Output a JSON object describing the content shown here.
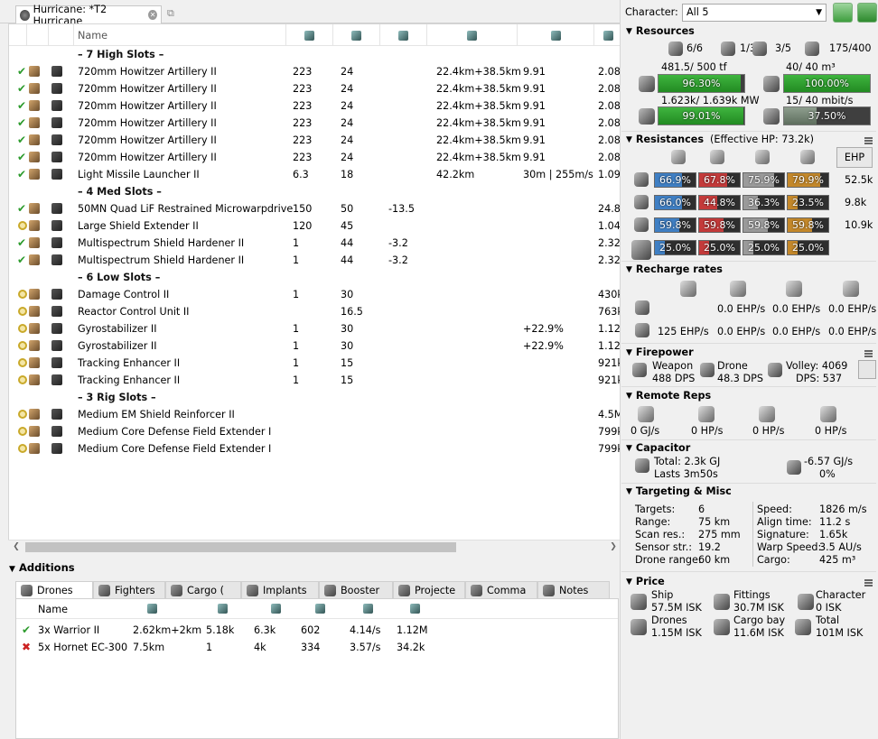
{
  "title_tab": "Hurricane: *T2 Hurricane",
  "fit_header": {
    "name": "Name"
  },
  "fit_rows": [
    {
      "type": "section",
      "label": "– 7 High Slots –"
    },
    {
      "type": "mod",
      "state": "ok",
      "name": "720mm Howitzer Artillery II",
      "c1": "223",
      "c2": "24",
      "c3": "",
      "c4": "22.4km+38.5km",
      "c5": "9.91",
      "c6": "2.08M"
    },
    {
      "type": "mod",
      "state": "ok",
      "name": "720mm Howitzer Artillery II",
      "c1": "223",
      "c2": "24",
      "c3": "",
      "c4": "22.4km+38.5km",
      "c5": "9.91",
      "c6": "2.08M"
    },
    {
      "type": "mod",
      "state": "ok",
      "name": "720mm Howitzer Artillery II",
      "c1": "223",
      "c2": "24",
      "c3": "",
      "c4": "22.4km+38.5km",
      "c5": "9.91",
      "c6": "2.08M"
    },
    {
      "type": "mod",
      "state": "ok",
      "name": "720mm Howitzer Artillery II",
      "c1": "223",
      "c2": "24",
      "c3": "",
      "c4": "22.4km+38.5km",
      "c5": "9.91",
      "c6": "2.08M"
    },
    {
      "type": "mod",
      "state": "ok",
      "name": "720mm Howitzer Artillery II",
      "c1": "223",
      "c2": "24",
      "c3": "",
      "c4": "22.4km+38.5km",
      "c5": "9.91",
      "c6": "2.08M"
    },
    {
      "type": "mod",
      "state": "ok",
      "name": "720mm Howitzer Artillery II",
      "c1": "223",
      "c2": "24",
      "c3": "",
      "c4": "22.4km+38.5km",
      "c5": "9.91",
      "c6": "2.08M"
    },
    {
      "type": "mod",
      "state": "ok",
      "name": "Light Missile Launcher II",
      "c1": "6.3",
      "c2": "18",
      "c3": "",
      "c4": "42.2km",
      "c5": "30m | 255m/s",
      "c6": "1.09M"
    },
    {
      "type": "section",
      "label": "– 4 Med Slots –"
    },
    {
      "type": "mod",
      "state": "ok",
      "name": "50MN Quad LiF Restrained Microwarpdrive",
      "c1": "150",
      "c2": "50",
      "c3": "-13.5",
      "c4": "",
      "c5": "",
      "c6": "24.8k"
    },
    {
      "type": "mod",
      "state": "off",
      "name": "Large Shield Extender II",
      "c1": "120",
      "c2": "45",
      "c3": "",
      "c4": "",
      "c5": "",
      "c6": "1.04M"
    },
    {
      "type": "mod",
      "state": "ok",
      "name": "Multispectrum Shield Hardener II",
      "c1": "1",
      "c2": "44",
      "c3": "-3.2",
      "c4": "",
      "c5": "",
      "c6": "2.32M"
    },
    {
      "type": "mod",
      "state": "ok",
      "name": "Multispectrum Shield Hardener II",
      "c1": "1",
      "c2": "44",
      "c3": "-3.2",
      "c4": "",
      "c5": "",
      "c6": "2.32M"
    },
    {
      "type": "section",
      "label": "– 6 Low Slots –"
    },
    {
      "type": "mod",
      "state": "off",
      "name": "Damage Control II",
      "c1": "1",
      "c2": "30",
      "c3": "",
      "c4": "",
      "c5": "",
      "c6": "430k"
    },
    {
      "type": "mod",
      "state": "off",
      "name": "Reactor Control Unit II",
      "c1": "",
      "c2": "16.5",
      "c3": "",
      "c4": "",
      "c5": "",
      "c6": "763k"
    },
    {
      "type": "mod",
      "state": "off",
      "name": "Gyrostabilizer II",
      "c1": "1",
      "c2": "30",
      "c3": "",
      "c4": "",
      "c5": "+22.9%",
      "c6": "1.12M"
    },
    {
      "type": "mod",
      "state": "off",
      "name": "Gyrostabilizer II",
      "c1": "1",
      "c2": "30",
      "c3": "",
      "c4": "",
      "c5": "+22.9%",
      "c6": "1.12M"
    },
    {
      "type": "mod",
      "state": "off",
      "name": "Tracking Enhancer II",
      "c1": "1",
      "c2": "15",
      "c3": "",
      "c4": "",
      "c5": "",
      "c6": "921k"
    },
    {
      "type": "mod",
      "state": "off",
      "name": "Tracking Enhancer II",
      "c1": "1",
      "c2": "15",
      "c3": "",
      "c4": "",
      "c5": "",
      "c6": "921k"
    },
    {
      "type": "section",
      "label": "– 3 Rig Slots –"
    },
    {
      "type": "mod",
      "state": "off",
      "name": "Medium EM Shield Reinforcer II",
      "c1": "",
      "c2": "",
      "c3": "",
      "c4": "",
      "c5": "",
      "c6": "4.5M"
    },
    {
      "type": "mod",
      "state": "off",
      "name": "Medium Core Defense Field Extender I",
      "c1": "",
      "c2": "",
      "c3": "",
      "c4": "",
      "c5": "",
      "c6": "799k"
    },
    {
      "type": "mod",
      "state": "off",
      "name": "Medium Core Defense Field Extender I",
      "c1": "",
      "c2": "",
      "c3": "",
      "c4": "",
      "c5": "",
      "c6": "799k"
    }
  ],
  "additions": {
    "title": "Additions",
    "tabs": [
      "Drones",
      "Fighters",
      "Cargo (",
      "Implants",
      "Booster",
      "Projecte",
      "Comma",
      "Notes"
    ],
    "header": {
      "name": "Name"
    },
    "drones": [
      {
        "state": "ok",
        "name": "3x Warrior II",
        "c1": "2.62km+2km",
        "c2": "5.18k",
        "c3": "6.3k",
        "c4": "602",
        "c5": "4.14/s",
        "c6": "1.12M"
      },
      {
        "state": "x",
        "name": "5x Hornet EC-300",
        "c1": "7.5km",
        "c2": "1",
        "c3": "4k",
        "c4": "334",
        "c5": "3.57/s",
        "c6": "34.2k"
      }
    ]
  },
  "character": {
    "label": "Character:",
    "value": "All 5"
  },
  "resources": {
    "title": "Resources",
    "hi": "6/6",
    "turret": "1/3",
    "launcher": "3/5",
    "calib": "175/400",
    "cpu_text": "481.5/ 500 tf",
    "cpu_pct": "96.30%",
    "cpu_frac": 0.963,
    "drone_bay": "40/ 40 m³",
    "drone_bay_pct": "100.00%",
    "drone_bay_frac": 1.0,
    "pg_text": "1.623k/ 1.639k MW",
    "pg_pct": "99.01%",
    "pg_frac": 0.9901,
    "bandwidth": "15/ 40 mbit/s",
    "bandwidth_pct": "37.50%",
    "bandwidth_frac": 0.375
  },
  "resistances": {
    "title": "Resistances",
    "ehp_total": "(Effective HP: 73.2k)",
    "ehp_button": "EHP",
    "rows": [
      {
        "layer": "shield",
        "vals": [
          "66.9%",
          "67.8%",
          "75.9%",
          "79.9%"
        ],
        "fr": [
          0.669,
          0.678,
          0.759,
          0.799
        ],
        "ehp": "52.5k"
      },
      {
        "layer": "armor",
        "vals": [
          "66.0%",
          "44.8%",
          "36.3%",
          "23.5%"
        ],
        "fr": [
          0.66,
          0.448,
          0.363,
          0.235
        ],
        "ehp": "9.8k"
      },
      {
        "layer": "hull",
        "vals": [
          "59.8%",
          "59.8%",
          "59.8%",
          "59.8%"
        ],
        "fr": [
          0.598,
          0.598,
          0.598,
          0.598
        ],
        "ehp": "10.9k"
      },
      {
        "layer": "damage-pattern",
        "vals": [
          "25.0%",
          "25.0%",
          "25.0%",
          "25.0%"
        ],
        "fr": [
          0.25,
          0.25,
          0.25,
          0.25
        ],
        "ehp": ""
      }
    ],
    "colors": [
      "#3f7fc4",
      "#c43a3a",
      "#9a9a9a",
      "#c4882a"
    ]
  },
  "recharge": {
    "title": "Recharge rates",
    "r1": [
      "0.0 EHP/s",
      "0.0 EHP/s",
      "0.0 EHP/s"
    ],
    "r2": [
      "125 EHP/s",
      "0.0 EHP/s",
      "0.0 EHP/s",
      "0.0 EHP/s"
    ]
  },
  "firepower": {
    "title": "Firepower",
    "weapon_label": "Weapon",
    "weapon_dps": "488 DPS",
    "drone_label": "Drone",
    "drone_dps": "48.3 DPS",
    "volley": "Volley: 4069",
    "dps": "DPS: 537"
  },
  "remote": {
    "title": "Remote Reps",
    "vals": [
      "0 GJ/s",
      "0 HP/s",
      "0 HP/s",
      "0 HP/s"
    ]
  },
  "capacitor": {
    "title": "Capacitor",
    "total": "Total: 2.3k GJ",
    "lasts": "Lasts 3m50s",
    "delta": "-6.57 GJ/s",
    "pct": "0%"
  },
  "targeting": {
    "title": "Targeting & Misc",
    "left": [
      [
        "Targets:",
        "6"
      ],
      [
        "Range:",
        "75 km"
      ],
      [
        "Scan res.:",
        "275 mm"
      ],
      [
        "Sensor str.:",
        "19.2"
      ],
      [
        "Drone range:",
        "60 km"
      ]
    ],
    "right": [
      [
        "Speed:",
        "1826 m/s"
      ],
      [
        "Align time:",
        "11.2 s"
      ],
      [
        "Signature:",
        "1.65k"
      ],
      [
        "Warp Speed:",
        "3.5 AU/s"
      ],
      [
        "Cargo:",
        "425 m³"
      ]
    ]
  },
  "price": {
    "title": "Price",
    "items": [
      [
        "Ship",
        "57.5M ISK"
      ],
      [
        "Fittings",
        "30.7M ISK"
      ],
      [
        "Character",
        "0 ISK"
      ],
      [
        "Drones",
        "1.15M ISK"
      ],
      [
        "Cargo bay",
        "11.6M ISK"
      ],
      [
        "Total",
        "101M ISK"
      ]
    ]
  }
}
